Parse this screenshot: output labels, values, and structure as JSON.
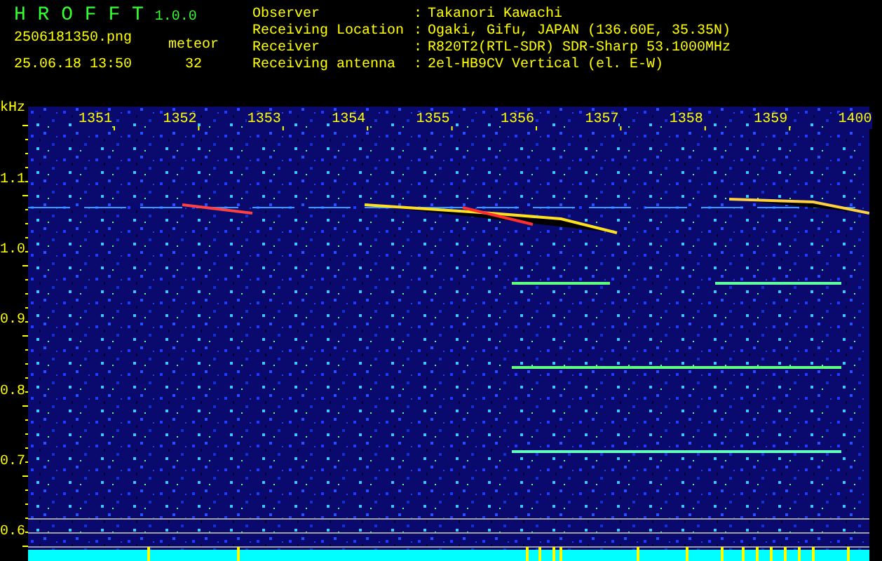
{
  "header": {
    "app_name": "H R O F F T",
    "version": "1.0.0",
    "file_name": "2506181350.png",
    "timestamp": "25.06.18 13:50",
    "count_label": "meteor",
    "count": "32"
  },
  "station_info": [
    {
      "label": "Observer",
      "separator": ":",
      "value": "Takanori Kawachi"
    },
    {
      "label": "Receiving Location",
      "separator": ":",
      "value": "Ogaki, Gifu, JAPAN (136.60E, 35.35N)"
    },
    {
      "label": "Receiver",
      "separator": ":",
      "value": "R820T2(RTL-SDR) SDR-Sharp 53.1000MHz"
    },
    {
      "label": "Receiving antenna",
      "separator": ":",
      "value": "2el-HB9CV Vertical (el. E-W)"
    }
  ],
  "spectrogram": {
    "unit": "kHz",
    "time_labels": [
      "1351",
      "1352",
      "1353",
      "1354",
      "1355",
      "1356",
      "1357",
      "1358",
      "1359",
      "1400"
    ],
    "frequency_labels": [
      "1.1",
      "1.0",
      "0.9",
      "0.8",
      "0.7",
      "0.6"
    ]
  }
}
